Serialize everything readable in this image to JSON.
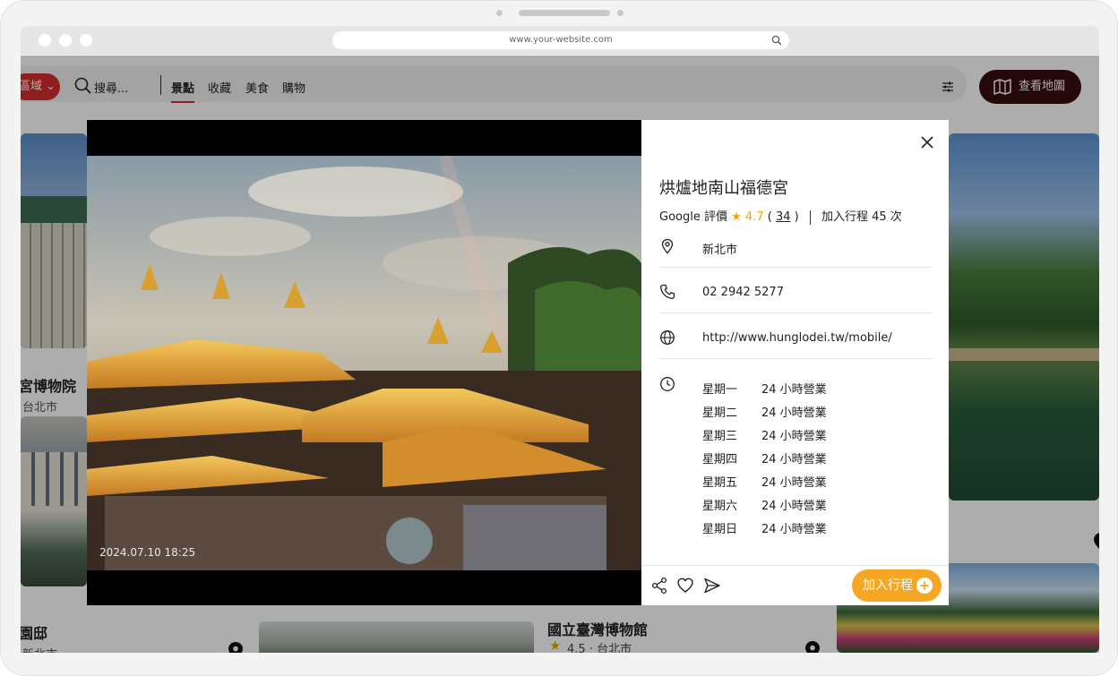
{
  "browser": {
    "url": "www.your-website.com"
  },
  "topbar": {
    "region_label": "區域",
    "search_placeholder": "搜尋...",
    "tabs": [
      "景點",
      "收藏",
      "美食",
      "購物"
    ],
    "map_button": "查看地圖"
  },
  "cards": [
    {
      "title": "宮博物院",
      "sub": "台北市"
    },
    {
      "title": "園邸",
      "sub": "新北市"
    },
    {
      "title": "國立臺灣博物館",
      "sub": "4.5 · 台北市"
    }
  ],
  "modal": {
    "photo_timestamp": "2024.07.10 18:25",
    "place_name": "烘爐地南山福德宮",
    "rating_label": "Google 評價",
    "rating_score": "4.7",
    "review_count": "34",
    "trip_count_label": "加入行程 45 次",
    "location": "新北市",
    "phone": "02 2942 5277",
    "website": "http://www.hunglodei.tw/mobile/",
    "hours": [
      {
        "day": "星期一",
        "time": "24 小時營業"
      },
      {
        "day": "星期二",
        "time": "24 小時營業"
      },
      {
        "day": "星期三",
        "time": "24 小時營業"
      },
      {
        "day": "星期四",
        "time": "24 小時營業"
      },
      {
        "day": "星期五",
        "time": "24 小時營業"
      },
      {
        "day": "星期六",
        "time": "24 小時營業"
      },
      {
        "day": "星期日",
        "time": "24 小時營業"
      }
    ],
    "add_button": "加入行程"
  },
  "colors": {
    "brand_red": "#d32f2f",
    "accent_orange": "#f5a623",
    "map_button_bg": "#3a0d0d",
    "star": "#f0a500"
  }
}
